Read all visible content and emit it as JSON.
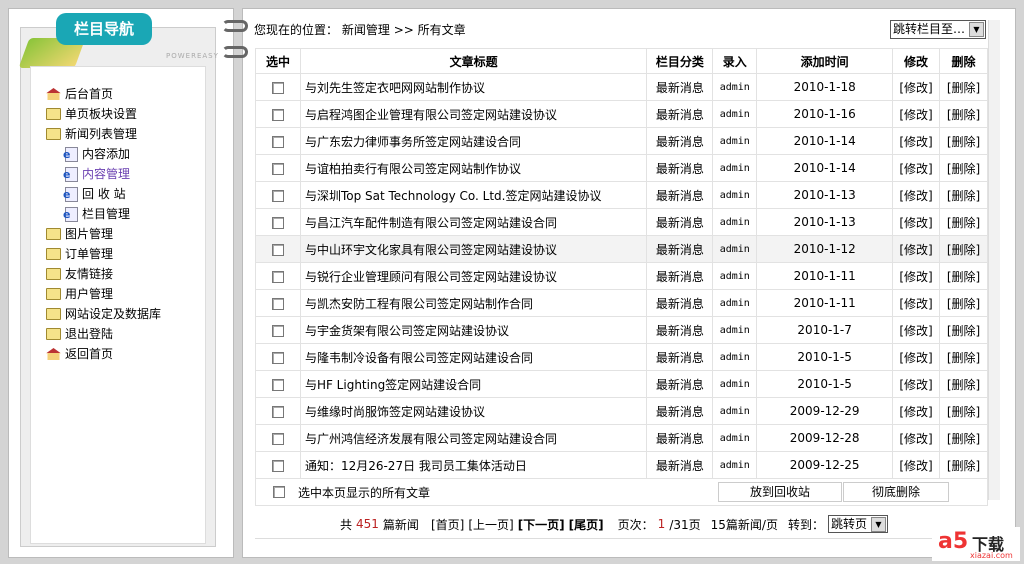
{
  "sidebar": {
    "title": "栏目导航",
    "powered": "POWEREASY",
    "items": [
      {
        "label": "后台首页",
        "icon": "home"
      },
      {
        "label": "单页板块设置",
        "icon": "folder"
      },
      {
        "label": "新闻列表管理",
        "icon": "folder-open"
      },
      {
        "label": "内容添加",
        "icon": "page",
        "sub": true
      },
      {
        "label": "内容管理",
        "icon": "page",
        "sub": true,
        "active": true
      },
      {
        "label": "回 收 站",
        "icon": "page",
        "sub": true
      },
      {
        "label": "栏目管理",
        "icon": "page",
        "sub": true
      },
      {
        "label": "图片管理",
        "icon": "folder"
      },
      {
        "label": "订单管理",
        "icon": "folder"
      },
      {
        "label": "友情链接",
        "icon": "folder"
      },
      {
        "label": "用户管理",
        "icon": "folder"
      },
      {
        "label": "网站设定及数据库",
        "icon": "folder"
      },
      {
        "label": "退出登陆",
        "icon": "folder"
      },
      {
        "label": "返回首页",
        "icon": "home"
      }
    ]
  },
  "breadcrumb": {
    "prefix": "您现在的位置：",
    "section": "新闻管理",
    "sep": ">>",
    "current": "所有文章"
  },
  "jump_select": "跳转栏目至…",
  "table": {
    "headers": [
      "选中",
      "文章标题",
      "栏目分类",
      "录入",
      "添加时间",
      "修改",
      "删除"
    ],
    "rows": [
      [
        "与刘先生签定衣吧网网站制作协议",
        "最新消息",
        "admin",
        "2010-1-18"
      ],
      [
        "与启程鸿图企业管理有限公司签定网站建设协议",
        "最新消息",
        "admin",
        "2010-1-16"
      ],
      [
        "与广东宏力律师事务所签定网站建设合同",
        "最新消息",
        "admin",
        "2010-1-14"
      ],
      [
        "与谊柏拍卖行有限公司签定网站制作协议",
        "最新消息",
        "admin",
        "2010-1-14"
      ],
      [
        "与深圳Top Sat Technology Co. Ltd.签定网站建设协议",
        "最新消息",
        "admin",
        "2010-1-13"
      ],
      [
        "与昌江汽车配件制造有限公司签定网站建设合同",
        "最新消息",
        "admin",
        "2010-1-13"
      ],
      [
        "与中山环宇文化家具有限公司签定网站建设协议",
        "最新消息",
        "admin",
        "2010-1-12"
      ],
      [
        "与锐行企业管理顾问有限公司签定网站建设协议",
        "最新消息",
        "admin",
        "2010-1-11"
      ],
      [
        "与凯杰安防工程有限公司签定网站制作合同",
        "最新消息",
        "admin",
        "2010-1-11"
      ],
      [
        "与宇金货架有限公司签定网站建设协议",
        "最新消息",
        "admin",
        "2010-1-7"
      ],
      [
        "与隆韦制冷设备有限公司签定网站建设合同",
        "最新消息",
        "admin",
        "2010-1-5"
      ],
      [
        "与HF Lighting签定网站建设合同",
        "最新消息",
        "admin",
        "2010-1-5"
      ],
      [
        "与维缘时尚服饰签定网站建设协议",
        "最新消息",
        "admin",
        "2009-12-29"
      ],
      [
        "与广州鸿信经济发展有限公司签定网站建设合同",
        "最新消息",
        "admin",
        "2009-12-28"
      ],
      [
        "通知：12月26-27日 我司员工集体活动日",
        "最新消息",
        "admin",
        "2009-12-25"
      ]
    ],
    "edit_label": "[修改]",
    "delete_label": "[删除]"
  },
  "footer": {
    "select_all": "选中本页显示的所有文章",
    "recycle_button": "放到回收站",
    "delete_button": "彻底删除"
  },
  "pager": {
    "total_prefix": "共",
    "total": "451",
    "total_suffix": "篇新闻",
    "first": "[首页]",
    "prev": "[上一页]",
    "next": "[下一页]",
    "last": "[尾页]",
    "page_label": "页次：",
    "page_current": "1",
    "page_total": "/31页",
    "per_page": "15篇新闻/页",
    "goto_label": "转到：",
    "goto_select": "跳转页"
  },
  "watermark": {
    "brand": "a5",
    "text": "下载",
    "site": "xiazai.com"
  }
}
